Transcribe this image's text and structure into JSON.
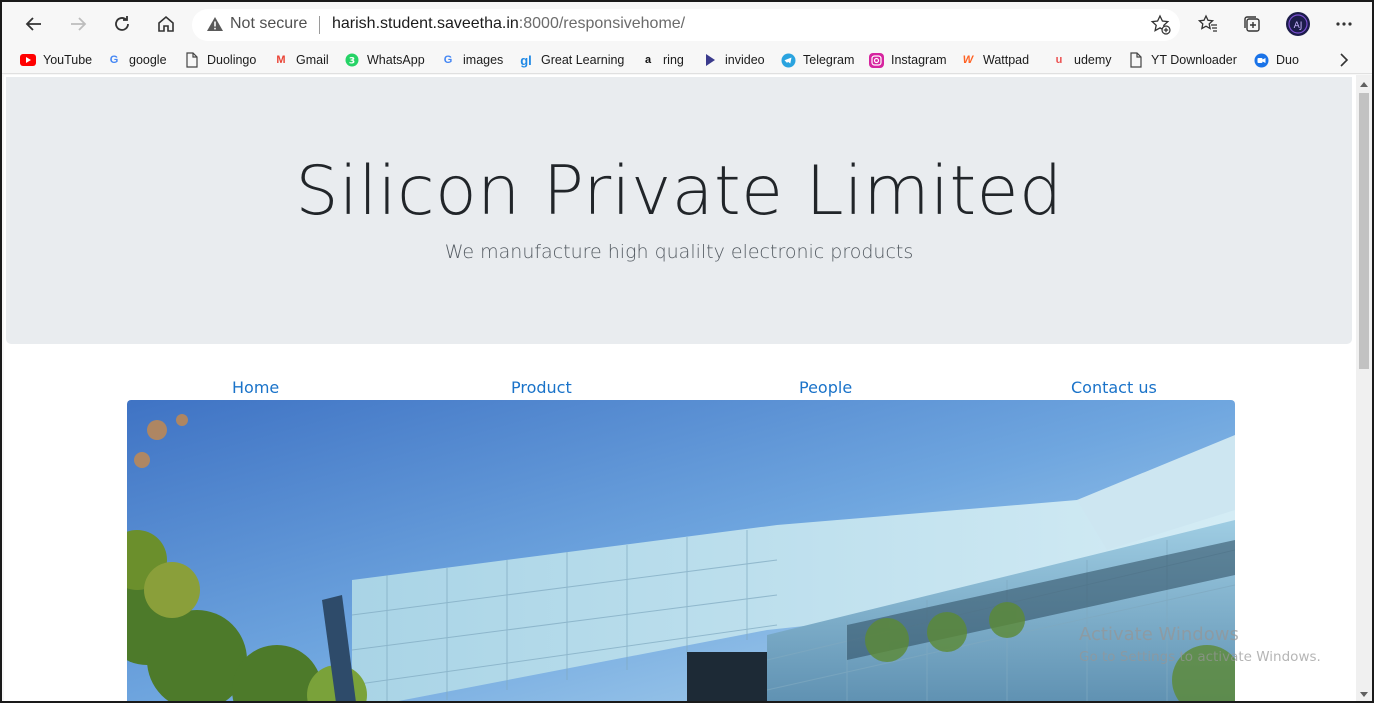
{
  "browser": {
    "security_text": "Not secure",
    "url_host": "harish.student.saveetha.in",
    "url_path": ":8000/responsivehome/",
    "icons": [
      "back-icon",
      "forward-icon",
      "refresh-icon",
      "home-icon",
      "warning-icon",
      "add-favorite-icon",
      "favorites-icon",
      "collections-icon",
      "profile-avatar",
      "more-menu-icon"
    ]
  },
  "bookmarks": [
    {
      "label": "YouTube",
      "icon": "youtube-icon",
      "color": "#ff0000"
    },
    {
      "label": "google",
      "icon": "google-icon",
      "color": "#4285f4"
    },
    {
      "label": "Duolingo",
      "icon": "page-icon",
      "color": "#555555"
    },
    {
      "label": "Gmail",
      "icon": "gmail-icon",
      "color": "#ea4335"
    },
    {
      "label": "WhatsApp",
      "icon": "whatsapp-icon",
      "color": "#25d366"
    },
    {
      "label": "images",
      "icon": "google-icon",
      "color": "#4285f4"
    },
    {
      "label": "Great Learning",
      "icon": "greatlearning-icon",
      "color": "#1e88e5"
    },
    {
      "label": "ring",
      "icon": "amazon-icon",
      "color": "#111111"
    },
    {
      "label": "invideo",
      "icon": "invideo-icon",
      "color": "#3a3a8c"
    },
    {
      "label": "Telegram",
      "icon": "telegram-icon",
      "color": "#2aa3df"
    },
    {
      "label": "Instagram",
      "icon": "instagram-icon",
      "color": "#d6249f"
    },
    {
      "label": "Wattpad",
      "icon": "wattpad-icon",
      "color": "#ff6122"
    },
    {
      "label": "udemy",
      "icon": "udemy-icon",
      "color": "#ec5252"
    },
    {
      "label": "YT Downloader",
      "icon": "page-icon",
      "color": "#555555"
    },
    {
      "label": "Duo",
      "icon": "duo-icon",
      "color": "#1a73e8"
    }
  ],
  "jumbotron": {
    "title": "Silicon Private Limited",
    "subtitle": "We manufacture high qualilty electronic products"
  },
  "nav": [
    "Home",
    "Product",
    "People",
    "Contact us"
  ],
  "watermark": {
    "line1": "Activate Windows",
    "line2": "Go to Settings to activate Windows."
  },
  "colors": {
    "link": "#1a73c9",
    "jumbotron_bg": "#e9ecef"
  }
}
